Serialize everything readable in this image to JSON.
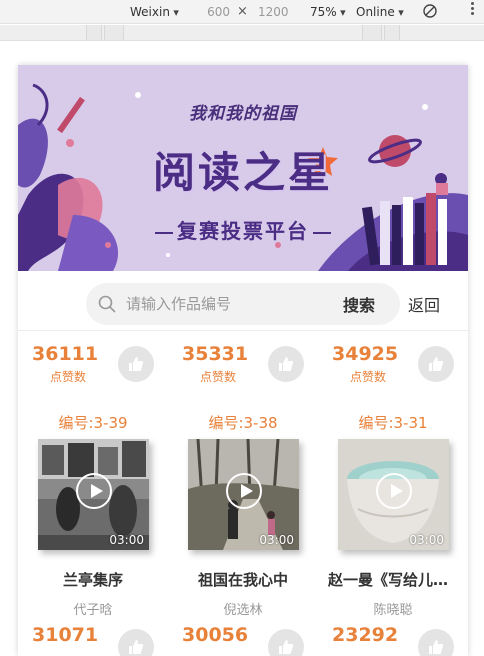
{
  "devtools": {
    "device": "Weixin",
    "width": "600",
    "times": "×",
    "height": "1200",
    "zoom": "75%",
    "throttle": "Online"
  },
  "banner": {
    "slogan": "我和我的祖国",
    "title": "阅读之星",
    "subtitle": "复赛投票平台"
  },
  "search": {
    "placeholder": "请输入作品编号",
    "value": "",
    "button_label": "搜索",
    "back_label": "返回"
  },
  "likes_label": "点赞数",
  "duration_label": "03:00",
  "top_row": [
    {
      "likes": "36111"
    },
    {
      "likes": "35331"
    },
    {
      "likes": "34925"
    }
  ],
  "works": [
    {
      "code": "编号:3-39",
      "title": "兰亭集序",
      "author": "代子晗",
      "likes": "31071"
    },
    {
      "code": "编号:3-38",
      "title": "祖国在我心中",
      "author": "倪选林",
      "likes": "30056"
    },
    {
      "code": "编号:3-31",
      "title": "赵一曼《写给儿子的信》",
      "author": "陈晓聪",
      "likes": "23292"
    }
  ],
  "colors": {
    "accent": "#e8813a",
    "banner_bg": "#d8cbea",
    "banner_text": "#4b2d85"
  }
}
